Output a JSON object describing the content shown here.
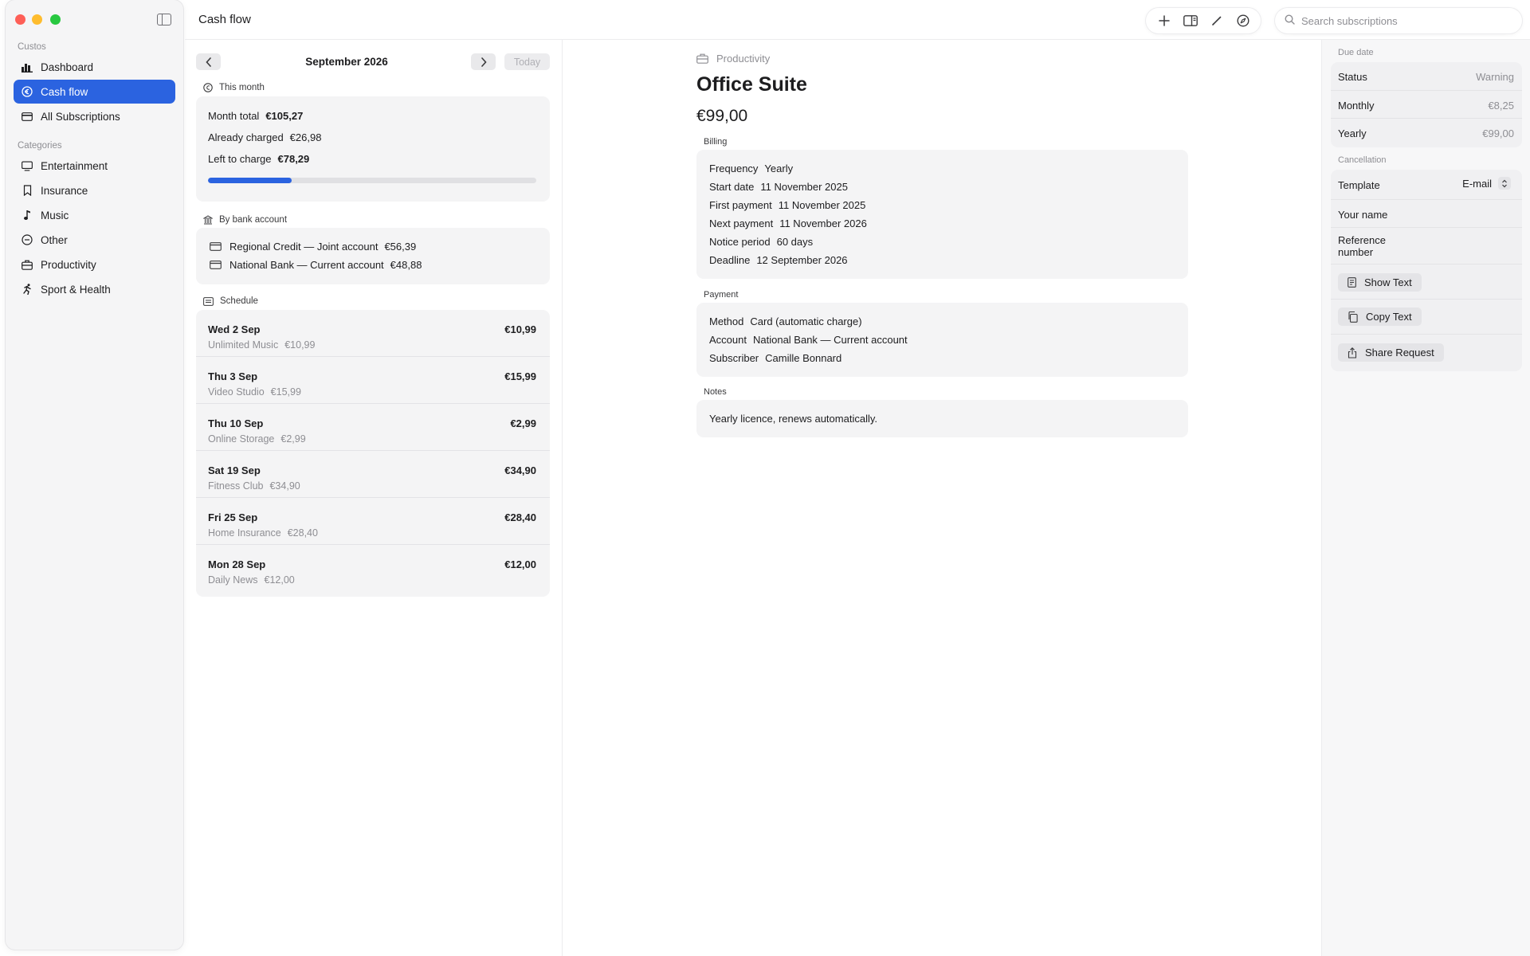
{
  "sidebar": {
    "section_main": "Custos",
    "items_main": [
      {
        "label": "Dashboard",
        "icon": "chart-bar-icon"
      },
      {
        "label": "Cash flow",
        "icon": "euro-circle-icon",
        "active": true
      },
      {
        "label": "All Subscriptions",
        "icon": "credit-card-icon"
      }
    ],
    "section_categories": "Categories",
    "categories": [
      {
        "label": "Entertainment",
        "icon": "tv-icon"
      },
      {
        "label": "Insurance",
        "icon": "bookmark-icon"
      },
      {
        "label": "Music",
        "icon": "music-note-icon"
      },
      {
        "label": "Other",
        "icon": "minus-circle-icon"
      },
      {
        "label": "Productivity",
        "icon": "briefcase-icon"
      },
      {
        "label": "Sport & Health",
        "icon": "running-figure-icon"
      }
    ]
  },
  "header": {
    "title": "Cash flow",
    "search_placeholder": "Search subscriptions"
  },
  "cashflow": {
    "month": "September 2026",
    "today_label": "Today",
    "this_month_heading": "This month",
    "month_total_label": "Month total",
    "month_total_value": "€105,27",
    "already_charged_label": "Already charged",
    "already_charged_value": "€26,98",
    "left_label": "Left to charge",
    "left_value": "€78,29",
    "charged_fraction": 0.256,
    "bank_heading": "By bank account",
    "banks": [
      {
        "name": "Regional Credit — Joint account",
        "amount": "€56,39"
      },
      {
        "name": "National Bank — Current account",
        "amount": "€48,88"
      }
    ],
    "schedule_heading": "Schedule",
    "schedule": [
      {
        "date": "Wed 2 Sep",
        "amount": "€10,99",
        "name": "Unlimited Music",
        "sub_amount": "€10,99"
      },
      {
        "date": "Thu 3 Sep",
        "amount": "€15,99",
        "name": "Video Studio",
        "sub_amount": "€15,99"
      },
      {
        "date": "Thu 10 Sep",
        "amount": "€2,99",
        "name": "Online Storage",
        "sub_amount": "€2,99"
      },
      {
        "date": "Sat 19 Sep",
        "amount": "€34,90",
        "name": "Fitness Club",
        "sub_amount": "€34,90"
      },
      {
        "date": "Fri 25 Sep",
        "amount": "€28,40",
        "name": "Home Insurance",
        "sub_amount": "€28,40"
      },
      {
        "date": "Mon 28 Sep",
        "amount": "€12,00",
        "name": "Daily News",
        "sub_amount": "€12,00"
      }
    ]
  },
  "detail": {
    "category": "Productivity",
    "title": "Office Suite",
    "price": "€99,00",
    "billing_heading": "Billing",
    "billing": [
      {
        "k": "Frequency",
        "v": "Yearly"
      },
      {
        "k": "Start date",
        "v": "11 November 2025"
      },
      {
        "k": "First payment",
        "v": "11 November 2025"
      },
      {
        "k": "Next payment",
        "v": "11 November 2026"
      },
      {
        "k": "Notice period",
        "v": "60 days"
      },
      {
        "k": "Deadline",
        "v": "12 September 2026"
      }
    ],
    "payment_heading": "Payment",
    "payment": [
      {
        "k": "Method",
        "v": "Card (automatic charge)"
      },
      {
        "k": "Account",
        "v": "National Bank — Current account"
      },
      {
        "k": "Subscriber",
        "v": "Camille Bonnard"
      }
    ],
    "notes_heading": "Notes",
    "notes": "Yearly licence, renews automatically."
  },
  "right_panel": {
    "due_heading": "Due date",
    "due": [
      {
        "k": "Status",
        "v": "Warning"
      },
      {
        "k": "Monthly",
        "v": "€8,25"
      },
      {
        "k": "Yearly",
        "v": "€99,00"
      }
    ],
    "cancel_heading": "Cancellation",
    "template_label": "Template",
    "template_value": "E-mail",
    "your_name_label": "Your name",
    "reference_label": "Reference number",
    "show_text": "Show Text",
    "copy_text": "Copy Text",
    "share_request": "Share Request"
  },
  "colors": {
    "accent": "#2b63e0",
    "sidebar_bg": "#f5f5f6",
    "card_bg": "#f4f4f5"
  }
}
